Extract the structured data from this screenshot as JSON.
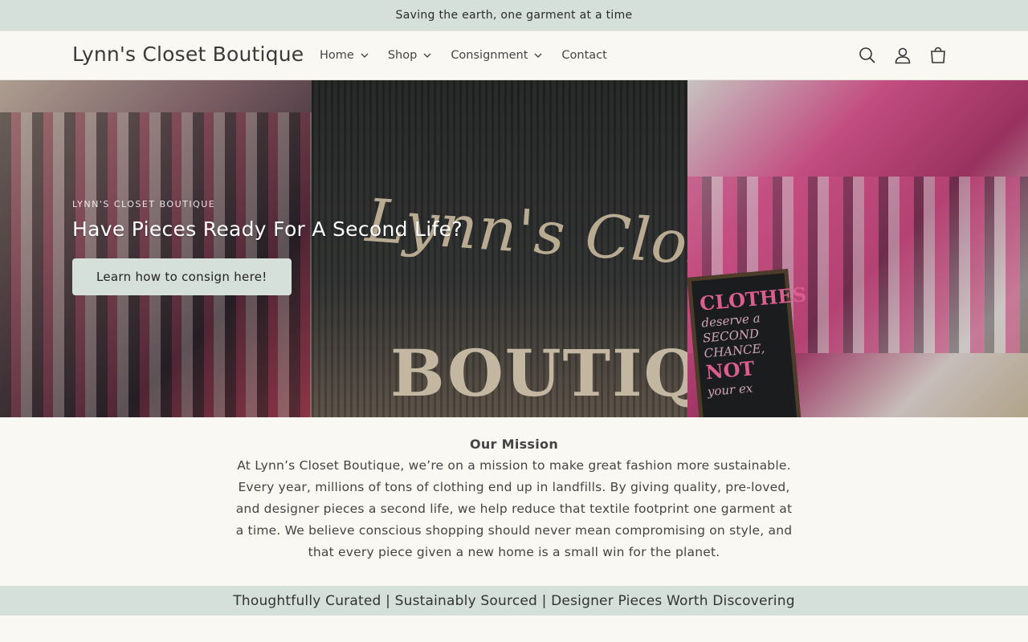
{
  "announcement": "Saving the earth, one garment at a time",
  "header": {
    "brand": "Lynn's Closet Boutique",
    "nav": [
      {
        "label": "Home",
        "has_dropdown": true
      },
      {
        "label": "Shop",
        "has_dropdown": true
      },
      {
        "label": "Consignment",
        "has_dropdown": true
      },
      {
        "label": "Contact",
        "has_dropdown": false
      }
    ],
    "icons": [
      "search-icon",
      "account-icon",
      "cart-icon"
    ]
  },
  "hero": {
    "eyebrow": "LYNN'S CLOSET BOUTIQUE",
    "title": "Have Pieces Ready For A Second Life?",
    "button": "Learn how to consign here!",
    "sign_script": "Lynn's Closet",
    "sign_block": "BOUTIQUE",
    "chalkboard": [
      "CLOTHES",
      "deserve a",
      "SECOND CHANCE,",
      "NOT",
      "your ex"
    ]
  },
  "mission": {
    "title": "Our Mission",
    "body": "At Lynn’s Closet Boutique, we’re on a mission to make great fashion more sustainable. Every year, millions of tons of clothing end up in landfills. By giving quality, pre-loved, and designer pieces a second life, we help reduce that textile footprint one garment at a time. We believe conscious shopping should never mean compromising on style, and that every piece given a new home is a small win for the planet."
  },
  "tagline": "Thoughtfully Curated | Sustainably Sourced | Designer Pieces Worth Discovering",
  "colors": {
    "accent": "#d6e0da",
    "background": "#f9f8f3"
  }
}
